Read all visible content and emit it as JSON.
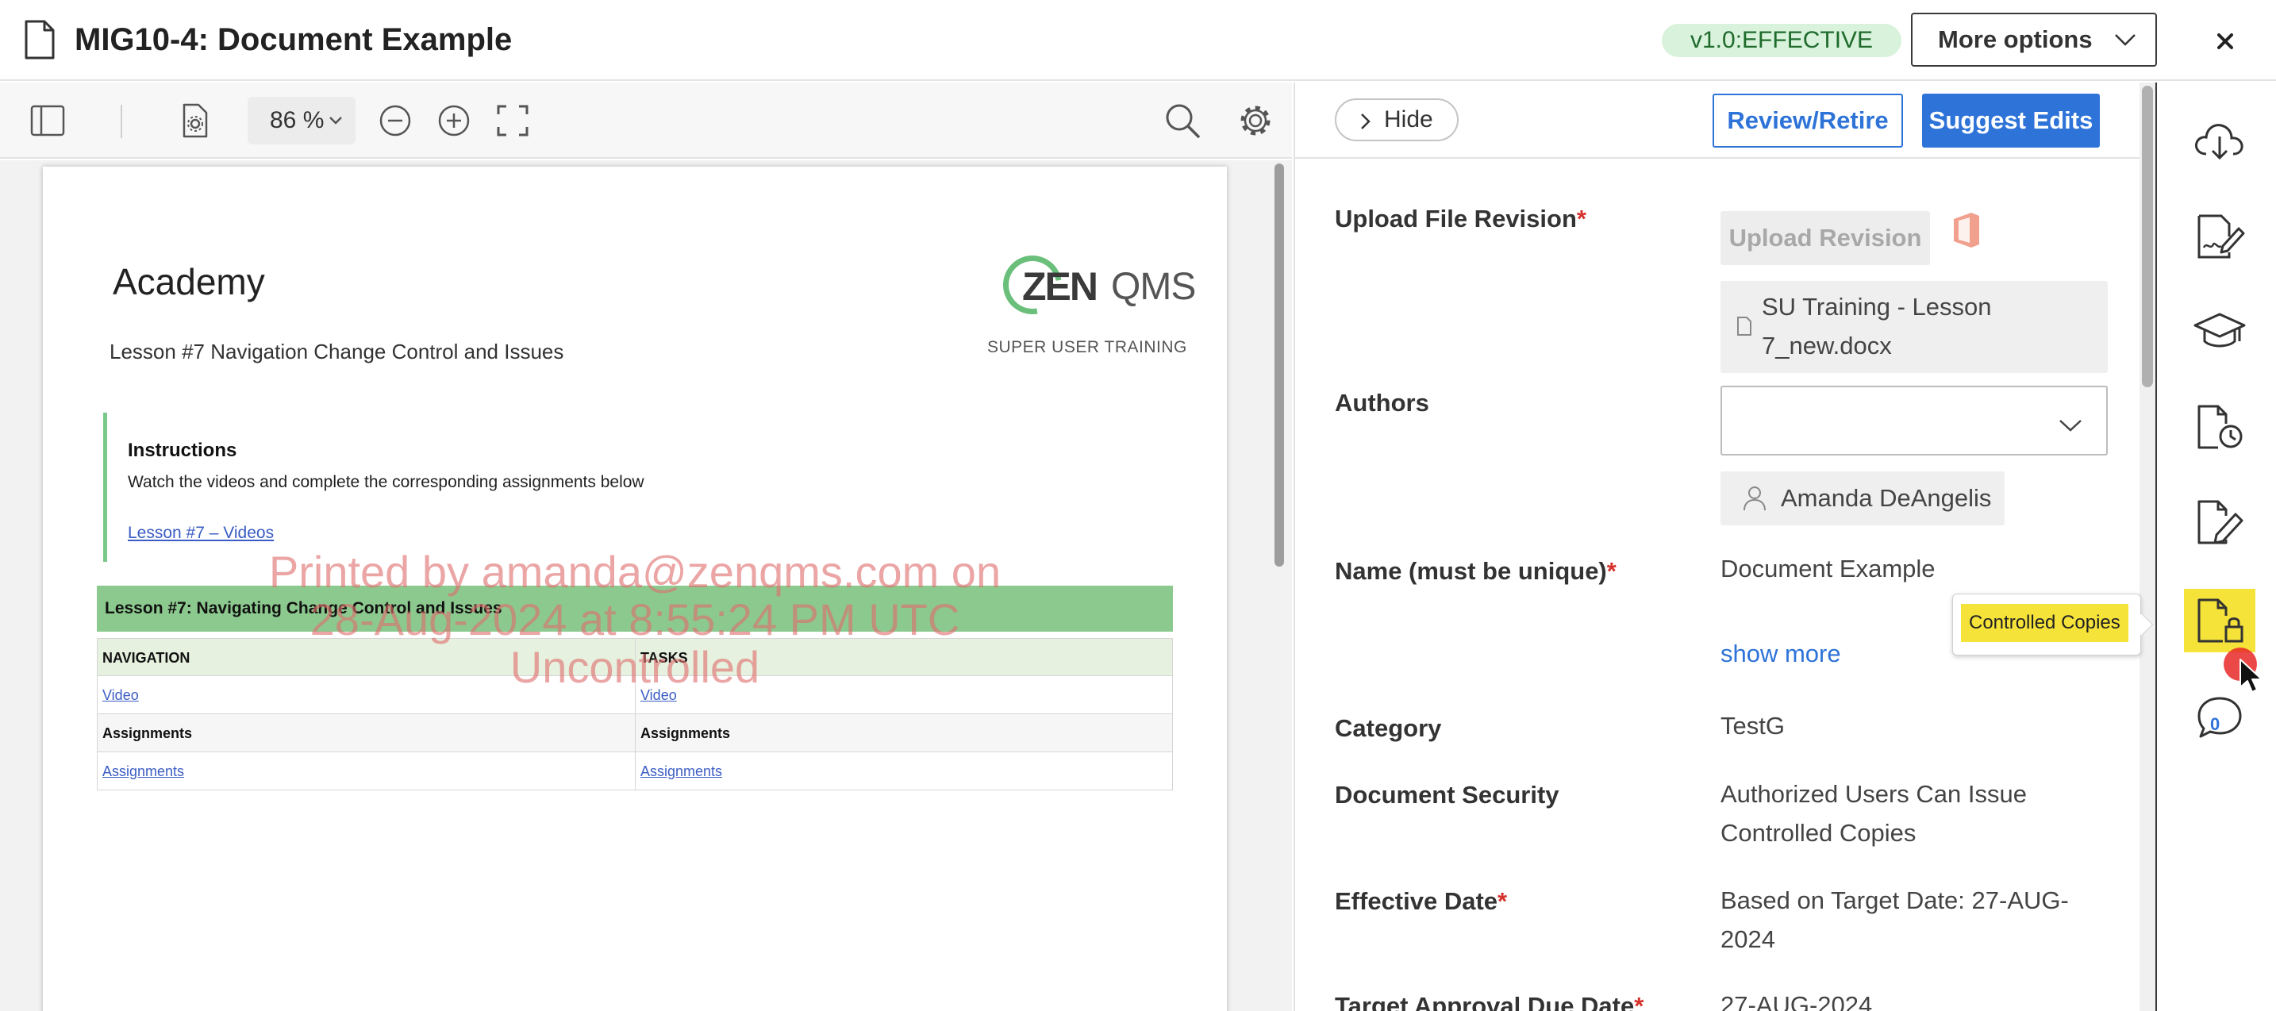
{
  "header": {
    "title": "MIG10-4: Document Example",
    "version_badge": "v1.0:EFFECTIVE",
    "more_options_label": "More options"
  },
  "viewer_toolbar": {
    "zoom_value": "86 %"
  },
  "document_page": {
    "academy_title": "Academy",
    "lesson_title": "Lesson #7 Navigation Change Control and Issues",
    "logo_text_bold": "ZEN",
    "logo_text_light": "QMS",
    "super_user_label": "SUPER USER TRAINING",
    "instructions_title": "Instructions",
    "instructions_text": "Watch the videos and complete the corresponding assignments below",
    "instructions_link": "Lesson #7 – Videos",
    "table_title": "Lesson #7: Navigating Change Control and Issues",
    "table_headers": [
      "NAVIGATION",
      "TASKS"
    ],
    "table_rows": [
      [
        "Video",
        "Video"
      ],
      [
        "Assignments",
        "Assignments"
      ],
      [
        "Assignments",
        "Assignments"
      ]
    ],
    "watermark_lines": [
      "Printed by amanda@zenqms.com on",
      "28-Aug-2024 at 8:55:24 PM UTC",
      "Uncontrolled"
    ]
  },
  "panel": {
    "hide_label": "Hide",
    "review_retire_label": "Review/Retire",
    "suggest_edits_label": "Suggest Edits",
    "fields": {
      "upload_file_revision": "Upload File Revision",
      "upload_revision_button": "Upload Revision",
      "file_name": "SU Training - Lesson 7_new.docx",
      "authors": "Authors",
      "author_name": "Amanda DeAngelis",
      "name_label": "Name (must be unique)",
      "name_value": "Document Example",
      "show_more": "show more",
      "category_label": "Category",
      "category_value": "TestG",
      "security_label": "Document Security",
      "security_value": "Authorized Users Can Issue Controlled Copies",
      "effective_date_label": "Effective Date",
      "effective_date_value": "Based on Target Date: 27-AUG-2024",
      "target_approval_label": "Target Approval Due Date",
      "target_approval_value": "27-AUG-2024"
    },
    "required_marker": "*"
  },
  "rail": {
    "comment_count": "0",
    "tooltip": "Controlled Copies",
    "active_color": "#f6e33a"
  },
  "colors": {
    "primary": "#2d73d8",
    "required": "#d6312b",
    "effective_badge_bg": "#d9f2dc",
    "table_header_green": "#8cc98e"
  },
  "icons": {
    "header": "document-icon",
    "close": "close-icon",
    "viewer_toolbar": [
      "sidebar-toggle-icon",
      "document-settings-icon",
      "zoom-out-icon",
      "zoom-in-icon",
      "fullscreen-icon",
      "search-icon",
      "gear-icon"
    ],
    "rail": [
      "cloud-download-icon",
      "signature-icon",
      "training-cap-icon",
      "document-history-icon",
      "edit-document-icon",
      "controlled-copy-lock-icon",
      "comment-icon"
    ]
  }
}
